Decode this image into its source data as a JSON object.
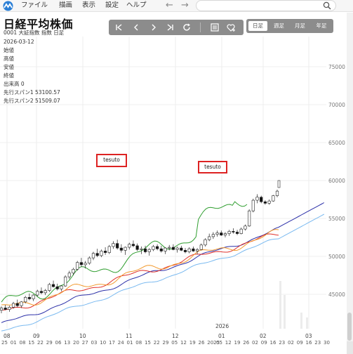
{
  "menubar": {
    "items": [
      "ファイル",
      "描画",
      "表示",
      "設定",
      "ヘルプ"
    ],
    "back_icon": "←",
    "forward_icon": "→",
    "search_placeholder": ""
  },
  "chart_header": {
    "title": "日経平均株価",
    "code_line": "0001 大証指数 指数  日足",
    "date": "2026-03-12",
    "open": "始値",
    "high": "高値",
    "low": "安値",
    "close": "終値",
    "volume": "出来高 0",
    "span1": "先行スパン1 53100.57",
    "span2": "先行スパン2 51509.07"
  },
  "toolbar": {
    "icons": [
      "skip-back-icon",
      "prev-icon",
      "next-icon",
      "skip-forward-icon",
      "refresh-icon",
      "list-icon",
      "favorite-add-icon"
    ]
  },
  "period": {
    "options": [
      "日足",
      "週足",
      "月足",
      "年足"
    ],
    "active": "日足"
  },
  "notes": [
    {
      "text": "tesuto"
    },
    {
      "text": "tesuto"
    }
  ],
  "chart_data": {
    "type": "candlestick",
    "y_ticks": [
      45000,
      50000,
      55000,
      60000,
      65000,
      70000,
      75000
    ],
    "ylim": [
      42500,
      80000
    ],
    "year_label": "2026",
    "months": [
      "08",
      "09",
      "10",
      "11",
      "12",
      "01",
      "02",
      "03"
    ],
    "day_ticks": [
      "25",
      "01",
      "08",
      "15",
      "22",
      "29",
      "06",
      "13",
      "20",
      "27",
      "03",
      "10",
      "17",
      "24",
      "01",
      "08",
      "15",
      "22",
      "29",
      "05",
      "12",
      "19",
      "26",
      "2025",
      "05",
      "12",
      "19",
      "26",
      "02",
      "09",
      "16",
      "23",
      "02",
      "09",
      "16",
      "23",
      "30"
    ],
    "candles": [
      [
        42900,
        43400,
        42500,
        43200
      ],
      [
        43200,
        43600,
        42900,
        43000
      ],
      [
        43000,
        43500,
        42700,
        43300
      ],
      [
        43300,
        44000,
        43100,
        43800
      ],
      [
        43800,
        44300,
        43300,
        43500
      ],
      [
        43500,
        44100,
        43200,
        44000
      ],
      [
        44000,
        44800,
        43800,
        44600
      ],
      [
        44600,
        45100,
        44200,
        44400
      ],
      [
        44400,
        45000,
        44100,
        44900
      ],
      [
        44900,
        45600,
        44700,
        45400
      ],
      [
        45400,
        45900,
        45000,
        45200
      ],
      [
        45200,
        45700,
        44900,
        45500
      ],
      [
        45500,
        46500,
        45300,
        46300
      ],
      [
        46300,
        46800,
        45900,
        46000
      ],
      [
        46000,
        46400,
        45500,
        45700
      ],
      [
        45700,
        46200,
        45400,
        46100
      ],
      [
        46100,
        47500,
        46000,
        47300
      ],
      [
        47300,
        48100,
        47000,
        47800
      ],
      [
        47800,
        48500,
        47500,
        48300
      ],
      [
        48300,
        49400,
        48100,
        49200
      ],
      [
        49200,
        49800,
        48600,
        48900
      ],
      [
        48900,
        49400,
        48400,
        49100
      ],
      [
        49100,
        50000,
        48900,
        49800
      ],
      [
        49800,
        50600,
        49500,
        50400
      ],
      [
        50400,
        51000,
        49900,
        50100
      ],
      [
        50100,
        50900,
        49900,
        50700
      ],
      [
        50700,
        51200,
        50200,
        50500
      ],
      [
        50500,
        51500,
        50300,
        51300
      ],
      [
        51300,
        52000,
        51000,
        51700
      ],
      [
        51700,
        52200,
        50900,
        51100
      ],
      [
        51100,
        51600,
        50500,
        50800
      ],
      [
        50800,
        51300,
        50200,
        51200
      ],
      [
        51200,
        51800,
        50900,
        51600
      ],
      [
        51600,
        52100,
        51200,
        51400
      ],
      [
        51400,
        51700,
        50700,
        50900
      ],
      [
        50900,
        51300,
        50300,
        51000
      ],
      [
        51000,
        51400,
        50400,
        50600
      ],
      [
        50600,
        51100,
        50100,
        50900
      ],
      [
        50900,
        51500,
        50700,
        51300
      ],
      [
        51300,
        51600,
        50800,
        51000
      ],
      [
        51000,
        51400,
        50500,
        50700
      ],
      [
        50700,
        51200,
        50300,
        51100
      ],
      [
        51100,
        51500,
        50800,
        51200
      ],
      [
        51200,
        51600,
        50800,
        50900
      ],
      [
        50900,
        51300,
        50500,
        51100
      ],
      [
        51100,
        51400,
        50700,
        50800
      ],
      [
        50800,
        51100,
        50400,
        50600
      ],
      [
        50600,
        51200,
        50400,
        51000
      ],
      [
        51000,
        51300,
        50600,
        50700
      ],
      [
        50700,
        51100,
        50300,
        50900
      ],
      [
        50900,
        51700,
        50800,
        51500
      ],
      [
        51500,
        52400,
        51300,
        52200
      ],
      [
        52200,
        53000,
        52000,
        52600
      ],
      [
        52600,
        53200,
        52300,
        52900
      ],
      [
        52900,
        53400,
        52600,
        53100
      ],
      [
        53100,
        53400,
        52700,
        52800
      ],
      [
        52800,
        53200,
        52500,
        53000
      ],
      [
        53000,
        53500,
        52700,
        53300
      ],
      [
        53300,
        53700,
        53000,
        53200
      ],
      [
        53200,
        53500,
        52800,
        53000
      ],
      [
        53000,
        53800,
        52900,
        53600
      ],
      [
        53600,
        54200,
        53400,
        54000
      ],
      [
        54000,
        56200,
        53900,
        56000
      ],
      [
        56000,
        57600,
        55800,
        57400
      ],
      [
        57400,
        58200,
        57000,
        57800
      ],
      [
        57800,
        58000,
        57000,
        57200
      ],
      [
        57200,
        57400,
        56800,
        57000
      ],
      [
        57000,
        57500,
        56800,
        57300
      ],
      [
        57300,
        58100,
        57200,
        58000
      ],
      [
        58000,
        58800,
        57800,
        58600
      ]
    ],
    "series": [
      {
        "name": "line-green",
        "color": "#2f9e2f"
      },
      {
        "name": "line-orange",
        "color": "#f29a2e"
      },
      {
        "name": "line-red",
        "color": "#e0302a"
      },
      {
        "name": "line-blue",
        "color": "#2b2fa8"
      },
      {
        "name": "line-lightblue",
        "color": "#79b9f0"
      }
    ]
  }
}
